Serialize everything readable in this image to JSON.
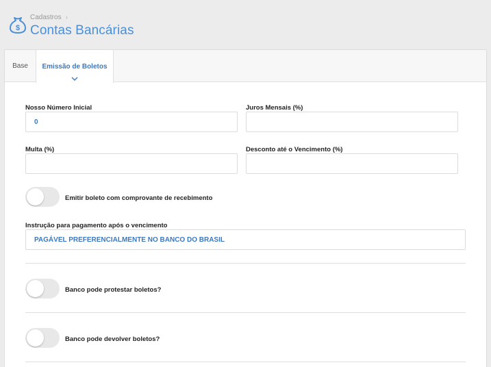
{
  "header": {
    "breadcrumb": "Cadastros",
    "title": "Contas Bancárias",
    "logo_icon": "money-bag-icon",
    "accent_color": "#4a90d9"
  },
  "tabs": [
    {
      "label": "Base",
      "active": false
    },
    {
      "label": "Emissão de Boletos",
      "active": true
    }
  ],
  "form": {
    "nosso_numero": {
      "label": "Nosso Número Inicial",
      "value": "0"
    },
    "juros": {
      "label": "Juros Mensais (%)",
      "value": ""
    },
    "multa": {
      "label": "Multa (%)",
      "value": ""
    },
    "desconto": {
      "label": "Desconto até o Vencimento (%)",
      "value": ""
    },
    "emitir_comprovante": {
      "label": "Emitir boleto com comprovante de recebimento",
      "checked": false
    },
    "instrucao": {
      "label": "Instrução para pagamento após o vencimento",
      "value": "PAGÁVEL PREFERENCIALMENTE NO BANCO DO BRASIL"
    },
    "protestar": {
      "label": "Banco pode protestar boletos?",
      "checked": false
    },
    "devolver": {
      "label": "Banco pode devolver boletos?",
      "checked": false
    }
  }
}
